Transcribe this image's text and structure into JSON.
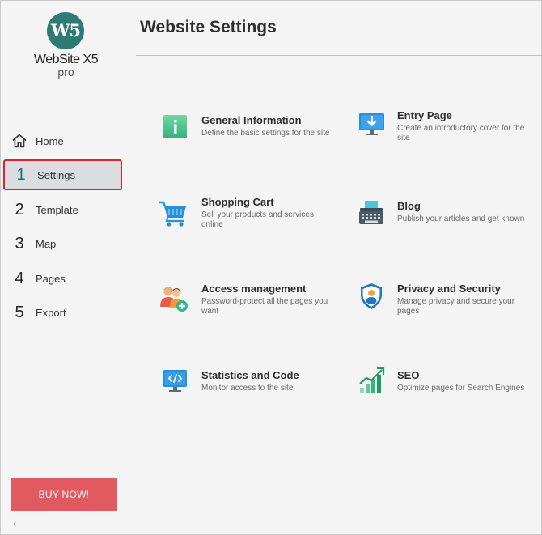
{
  "logo": {
    "badge": "W5",
    "name": "WebSite X5",
    "edition": "pro"
  },
  "nav": {
    "home": "Home",
    "items": [
      {
        "num": "1",
        "label": "Settings"
      },
      {
        "num": "2",
        "label": "Template"
      },
      {
        "num": "3",
        "label": "Map"
      },
      {
        "num": "4",
        "label": "Pages"
      },
      {
        "num": "5",
        "label": "Export"
      }
    ],
    "active_color": "#e2222a"
  },
  "buy_label": "BUY NOW!",
  "collapse_glyph": "‹",
  "page_title": "Website Settings",
  "cards": {
    "general": {
      "title": "General Information",
      "desc": "Define the basic settings for the site",
      "icon": "info-icon"
    },
    "entry": {
      "title": "Entry Page",
      "desc": "Create an introductory cover for the site",
      "icon": "monitor-download-icon"
    },
    "cart": {
      "title": "Shopping Cart",
      "desc": "Sell your products and services online",
      "icon": "shopping-cart-icon"
    },
    "blog": {
      "title": "Blog",
      "desc": "Publish your articles and get known",
      "icon": "typewriter-icon"
    },
    "access": {
      "title": "Access management",
      "desc": "Password-protect all the pages you want",
      "icon": "users-add-icon"
    },
    "privacy": {
      "title": "Privacy and Security",
      "desc": "Manage privacy and secure your pages",
      "icon": "shield-user-icon"
    },
    "stats": {
      "title": "Statistics and Code",
      "desc": "Monitor access to the site",
      "icon": "code-monitor-icon"
    },
    "seo": {
      "title": "SEO",
      "desc": "Optimize pages for Search Engines",
      "icon": "growth-chart-icon"
    }
  },
  "colors": {
    "brand": "#2e7b73",
    "buy": "#e05a5f",
    "accent_blue": "#2a8fd6",
    "green": "#4bc08f"
  }
}
